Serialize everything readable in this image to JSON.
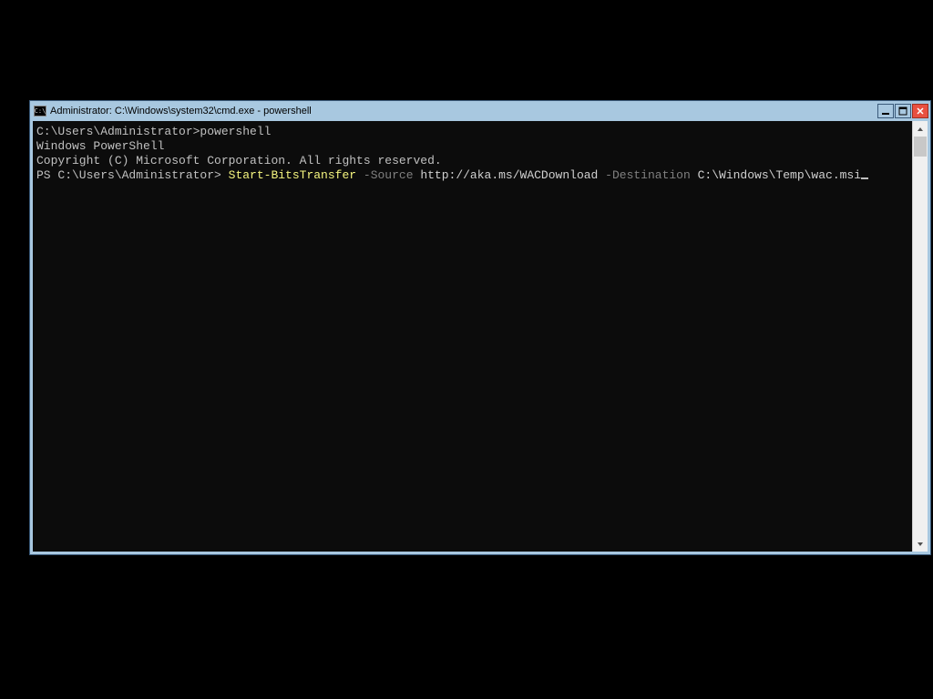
{
  "titlebar": {
    "icon_label": "C:\\",
    "title": "Administrator: C:\\Windows\\system32\\cmd.exe - powershell"
  },
  "terminal": {
    "lines": [
      {
        "segments": [
          {
            "cls": "",
            "text": "C:\\Users\\Administrator>powershell"
          }
        ]
      },
      {
        "segments": [
          {
            "cls": "",
            "text": "Windows PowerShell"
          }
        ]
      },
      {
        "segments": [
          {
            "cls": "",
            "text": "Copyright (C) Microsoft Corporation. All rights reserved."
          }
        ]
      },
      {
        "segments": [
          {
            "cls": "",
            "text": ""
          }
        ]
      },
      {
        "segments": [
          {
            "cls": "",
            "text": "PS C:\\Users\\Administrator> "
          },
          {
            "cls": "cmd-yellow",
            "text": "Start-BitsTransfer"
          },
          {
            "cls": "",
            "text": " "
          },
          {
            "cls": "cmd-gray",
            "text": "-Source"
          },
          {
            "cls": "",
            "text": " "
          },
          {
            "cls": "cmd-white",
            "text": "http://aka.ms/WACDownload"
          },
          {
            "cls": "",
            "text": " "
          },
          {
            "cls": "cmd-gray",
            "text": "-Destination"
          },
          {
            "cls": "",
            "text": " "
          },
          {
            "cls": "cmd-white",
            "text": "C:\\Windows\\Temp\\wac.msi"
          }
        ],
        "cursor": true
      }
    ]
  }
}
